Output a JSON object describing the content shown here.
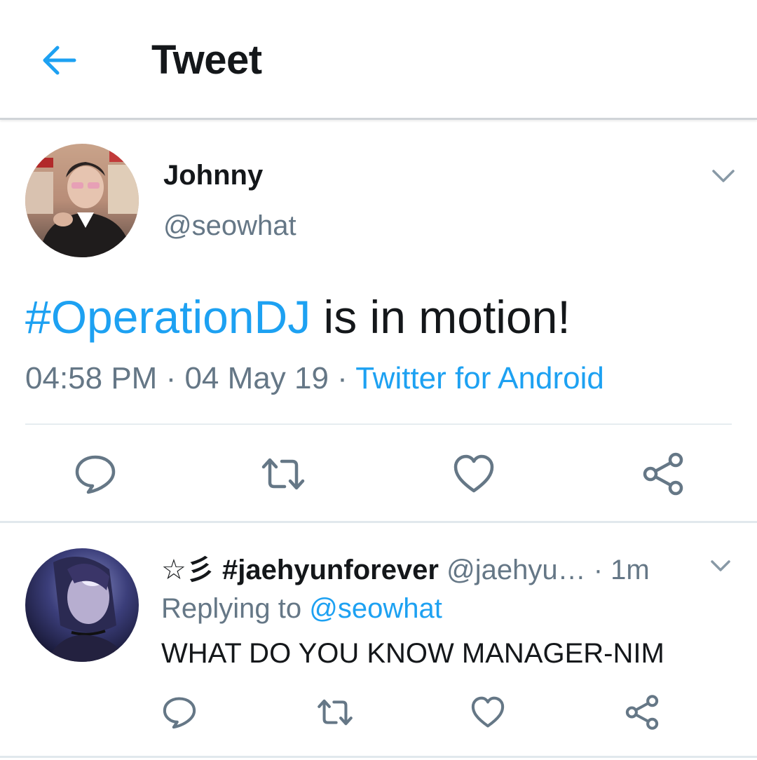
{
  "appbar": {
    "back_icon": "arrow-left-icon",
    "title": "Tweet"
  },
  "tweet": {
    "author_name": "Johnny",
    "author_handle": "@seowhat",
    "hashtag": "#OperationDJ",
    "text_rest": " is in motion!",
    "time": "04:58 PM",
    "dot1": " · ",
    "date": "04 May 19",
    "dot2": " · ",
    "source": "Twitter for Android",
    "actions": [
      "reply-icon",
      "retweet-icon",
      "like-icon",
      "share-icon"
    ]
  },
  "reply": {
    "name": "☆彡 #jaehyunforever",
    "handle": " @jaehyu…",
    "time": " · 1m",
    "replying_prefix": "Replying to ",
    "replying_to": "@seowhat",
    "text": "WHAT DO YOU KNOW MANAGER-NIM",
    "actions": [
      "reply-icon",
      "retweet-icon",
      "like-icon",
      "share-icon"
    ]
  },
  "colors": {
    "accent": "#1da1f2",
    "text": "#14171a",
    "secondary": "#657786",
    "icon": "#657786",
    "divider": "#e1e8ed"
  }
}
